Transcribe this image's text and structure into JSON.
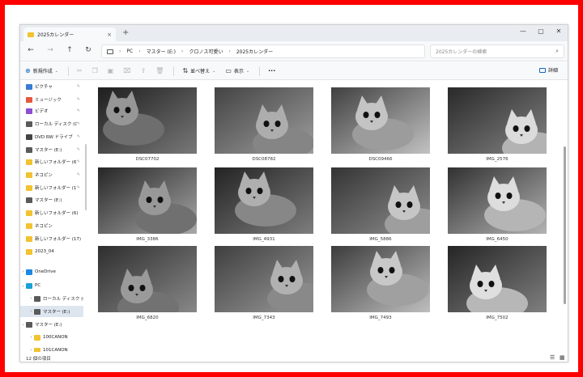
{
  "window": {
    "tab_title": "2025カレンダー",
    "tab_close": "×",
    "new_tab": "+",
    "minimize": "—",
    "maximize": "▢",
    "close": "✕"
  },
  "nav": {
    "back": "←",
    "forward": "→",
    "up": "↑",
    "refresh": "↻"
  },
  "breadcrumb": [
    "PC",
    "マスター (E:)",
    "クロノス可愛い",
    "2025カレンダー"
  ],
  "breadcrumb_sep": "›",
  "search": {
    "placeholder": "2025カレンダーの検索"
  },
  "toolbar": {
    "new_label": "新規作成",
    "sort_label": "並べ替え",
    "view_label": "表示",
    "more": "···",
    "details_label": "詳細"
  },
  "sidebar": {
    "items": [
      {
        "label": "ピクチャ",
        "icon": "pictures-icon",
        "color": "#3a7bd5",
        "pin": true
      },
      {
        "label": "ミュージック",
        "icon": "music-icon",
        "color": "#e4583e",
        "pin": true
      },
      {
        "label": "ビデオ",
        "icon": "video-icon",
        "color": "#8c4fd1",
        "pin": true
      },
      {
        "label": "ローカル ディスク (C",
        "icon": "drive-icon",
        "color": "#5a5a5a",
        "pin": true
      },
      {
        "label": "DVD RW ドライブ",
        "icon": "dvd-icon",
        "color": "#444444",
        "pin": true
      },
      {
        "label": "マスター (E:)",
        "icon": "drive-icon",
        "color": "#5a5a5a",
        "pin": true
      },
      {
        "label": "新しいフォルダー (6)",
        "icon": "folder-icon",
        "color": "#f2c230",
        "pin": true
      },
      {
        "label": "ネコピン",
        "icon": "folder-icon",
        "color": "#f2c230",
        "pin": true
      },
      {
        "label": "新しいフォルダー (17)",
        "icon": "folder-icon",
        "color": "#f2c230",
        "pin": true
      },
      {
        "label": "マスター (E:)",
        "icon": "drive-icon",
        "color": "#5a5a5a",
        "pin": false
      },
      {
        "label": "新しいフォルダー (6)",
        "icon": "folder-icon",
        "color": "#f2c230",
        "pin": false
      },
      {
        "label": "ネコピン",
        "icon": "folder-icon",
        "color": "#f2c230",
        "pin": false
      },
      {
        "label": "新しいフォルダー (17)",
        "icon": "folder-icon",
        "color": "#f2c230",
        "pin": false
      },
      {
        "label": "2023_04",
        "icon": "folder-icon",
        "color": "#f2c230",
        "pin": false
      },
      {
        "label": "OneDrive",
        "icon": "cloud-icon",
        "color": "#1e88e5",
        "pin": false
      },
      {
        "label": "PC",
        "icon": "pc-icon",
        "color": "#1aa1d6",
        "pin": false
      },
      {
        "label": "ローカル ディスク (C",
        "icon": "drive-icon",
        "color": "#5a5a5a",
        "pin": false
      },
      {
        "label": "マスター (E:)",
        "icon": "drive-icon",
        "color": "#5a5a5a",
        "pin": false
      },
      {
        "label": "マスター (E:)",
        "icon": "drive-icon",
        "color": "#5a5a5a",
        "pin": false
      },
      {
        "label": "100CANON",
        "icon": "folder-icon",
        "color": "#f2c230",
        "pin": false
      },
      {
        "label": "101CANON",
        "icon": "folder-icon",
        "color": "#f2c230",
        "pin": false
      }
    ]
  },
  "files": [
    {
      "name": "DSC07702"
    },
    {
      "name": "DSC08782"
    },
    {
      "name": "DSC09466"
    },
    {
      "name": "IMG_2576"
    },
    {
      "name": "IMG_3386"
    },
    {
      "name": "IMG_4931"
    },
    {
      "name": "IMG_5886"
    },
    {
      "name": "IMG_6450"
    },
    {
      "name": "IMG_6820"
    },
    {
      "name": "IMG_7343"
    },
    {
      "name": "IMG_7493"
    },
    {
      "name": "IMG_7502"
    }
  ],
  "status": {
    "count_text": "12 個の項目"
  }
}
